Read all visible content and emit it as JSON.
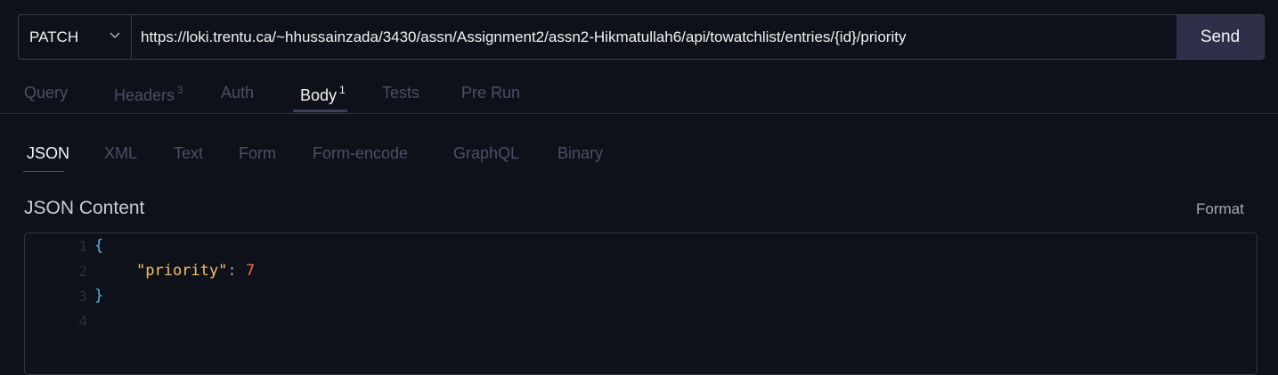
{
  "request": {
    "method": "PATCH",
    "url": "https://loki.trentu.ca/~hhussainzada/3430/assn/Assignment2/assn2-Hikmatullah6/api/towatchlist/entries/{id}/priority",
    "send_label": "Send"
  },
  "tabs": [
    {
      "label": "Query"
    },
    {
      "label": "Headers",
      "badge": "3"
    },
    {
      "label": "Auth"
    },
    {
      "label": "Body",
      "badge": "1"
    },
    {
      "label": "Tests"
    },
    {
      "label": "Pre Run"
    }
  ],
  "body_types": [
    "JSON",
    "XML",
    "Text",
    "Form",
    "Form-encode",
    "GraphQL",
    "Binary"
  ],
  "editor": {
    "title": "JSON Content",
    "format_label": "Format",
    "line_numbers": [
      "1",
      "2",
      "3",
      "4"
    ],
    "open_brace": "{",
    "key": "\"priority\"",
    "colon": ":",
    "value": "7",
    "close_brace": "}"
  }
}
